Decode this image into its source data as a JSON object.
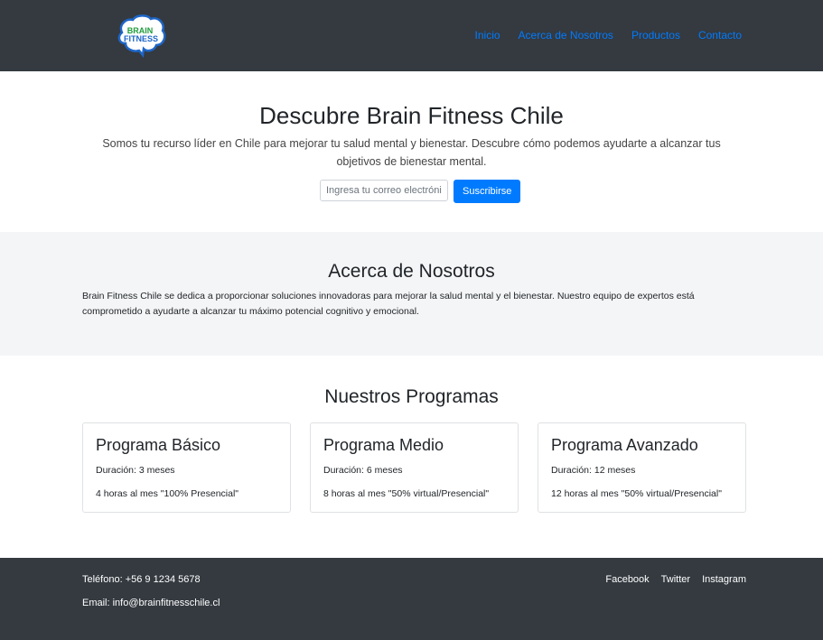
{
  "nav": {
    "logo_text_top": "BRAIN",
    "logo_text_bottom": "FITNESS",
    "links": [
      "Inicio",
      "Acerca de Nosotros",
      "Productos",
      "Contacto"
    ]
  },
  "hero": {
    "title": "Descubre Brain Fitness Chile",
    "subtitle": "Somos tu recurso líder en Chile para mejorar tu salud mental y bienestar. Descubre cómo podemos ayudarte a alcanzar tus objetivos de bienestar mental.",
    "email_placeholder": "Ingresa tu correo electrónico",
    "subscribe_label": "Suscribirse"
  },
  "about": {
    "title": "Acerca de Nosotros",
    "text": "Brain Fitness Chile se dedica a proporcionar soluciones innovadoras para mejorar la salud mental y el bienestar. Nuestro equipo de expertos está comprometido a ayudarte a alcanzar tu máximo potencial cognitivo y emocional."
  },
  "programs": {
    "title": "Nuestros Programas",
    "items": [
      {
        "name": "Programa Básico",
        "duration": "Duración: 3 meses",
        "hours": "4 horas al mes \"100% Presencial\""
      },
      {
        "name": "Programa Medio",
        "duration": "Duración: 6 meses",
        "hours": "8 horas al mes \"50% virtual/Presencial\""
      },
      {
        "name": "Programa Avanzado",
        "duration": "Duración: 12 meses",
        "hours": "12 horas al mes \"50% virtual/Presencial\""
      }
    ]
  },
  "footer": {
    "phone": "Teléfono: +56 9 1234 5678",
    "email": "Email: info@brainfitnesschile.cl",
    "social": [
      "Facebook",
      "Twitter",
      "Instagram"
    ]
  },
  "colors": {
    "navbar": "#343a40",
    "link": "#007bff",
    "about_bg": "#f4f5f6",
    "button": "#007bff"
  }
}
